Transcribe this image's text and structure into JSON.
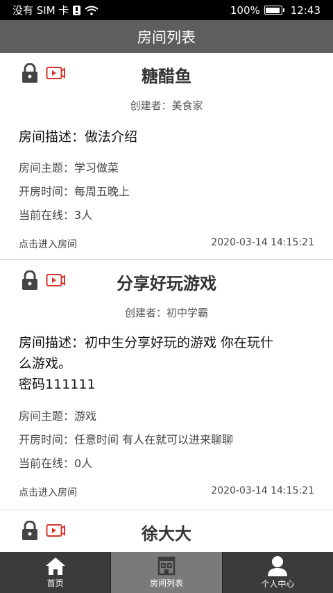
{
  "status_bar": {
    "carrier": "没有 SIM 卡",
    "battery_percent": "100%",
    "battery_level": 1.0,
    "time": "12:43"
  },
  "header": {
    "title": "房间列表"
  },
  "rooms": [
    {
      "title": "糖醋鱼",
      "creator": "创建者：美食家",
      "description_lines": [
        "房间描述：做法介绍"
      ],
      "topic": "房间主题：学习做菜",
      "open_time": "开房时间：每周五晚上",
      "online": "当前在线：3人",
      "enter_label": "点击进入房间",
      "timestamp": "2020-03-14 14:15:21",
      "icons": [
        "lock-icon",
        "video-icon"
      ]
    },
    {
      "title": "分享好玩游戏",
      "creator": "创建者：初中学霸",
      "description_lines": [
        "房间描述：初中生分享好玩的游戏 你在玩什",
        "么游戏。",
        "密码111111"
      ],
      "topic": "房间主题：游戏",
      "open_time": "开房时间：任意时间 有人在就可以进来聊聊",
      "online": "当前在线：0人",
      "enter_label": "点击进入房间",
      "timestamp": "2020-03-14 14:15:21",
      "icons": [
        "lock-icon",
        "video-icon"
      ]
    },
    {
      "title": "徐大大",
      "icons": [
        "lock-icon",
        "video-icon"
      ]
    }
  ],
  "tabbar": {
    "tabs": [
      {
        "label": "首页",
        "icon": "home-icon"
      },
      {
        "label": "房间列表",
        "icon": "room-list-icon",
        "active": true
      },
      {
        "label": "个人中心",
        "icon": "person-icon"
      }
    ]
  },
  "colors": {
    "header_bg": "#5e5e5e",
    "tabbar_bg": "#3b3b3b",
    "tab_active_bg": "#7a7a7a",
    "video_icon": "#d9342b"
  }
}
